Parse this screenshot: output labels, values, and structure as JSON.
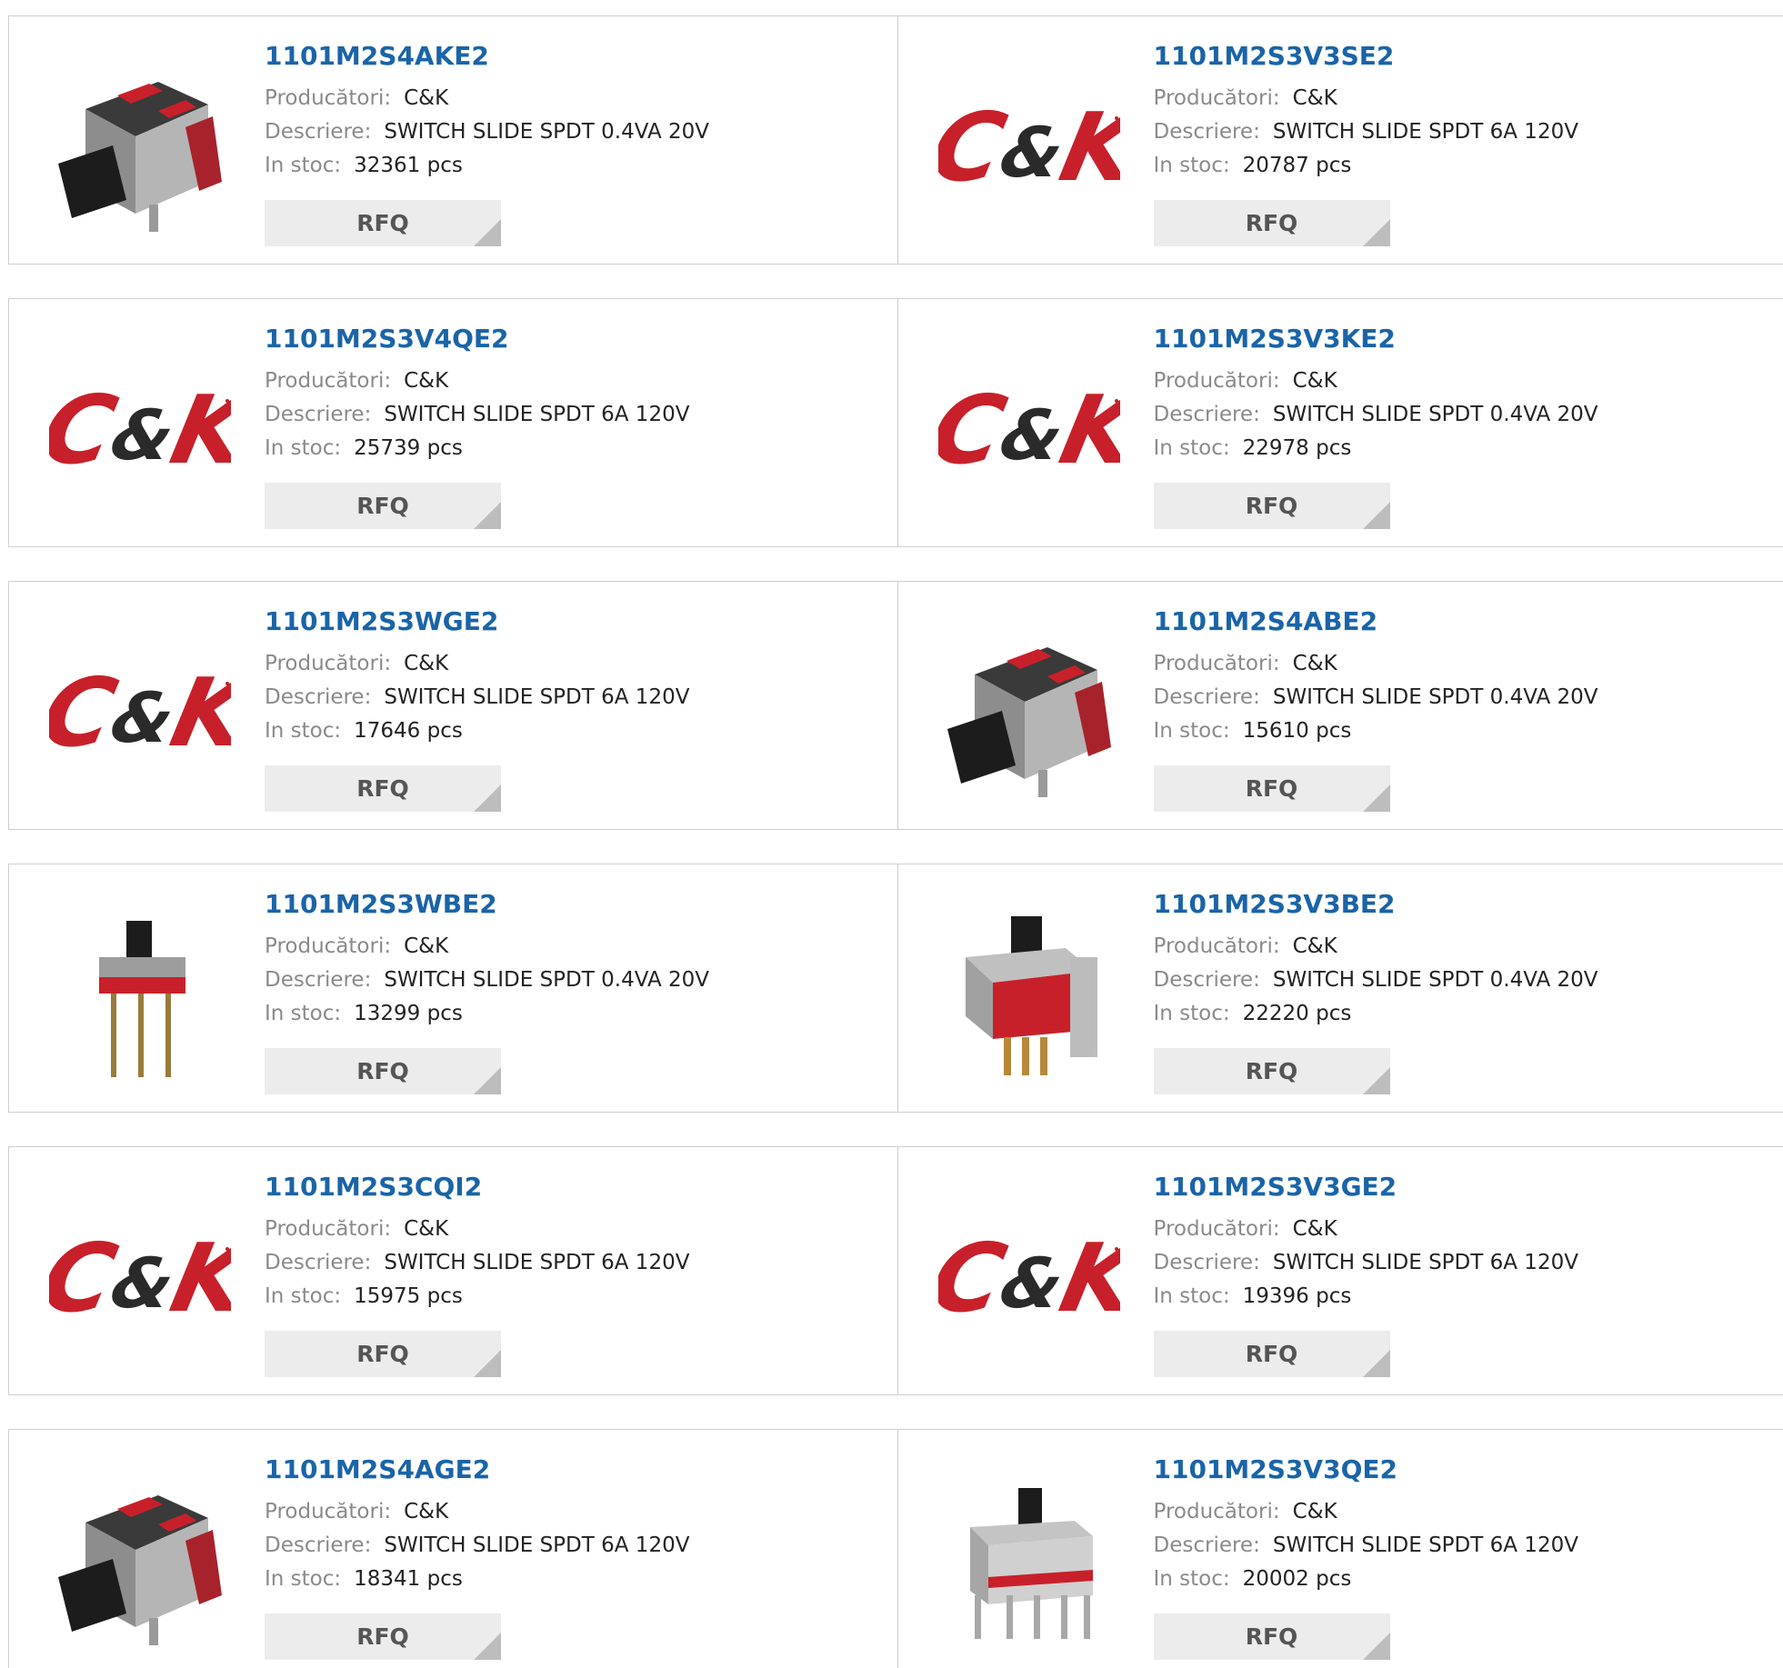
{
  "labels": {
    "manufacturer": "Producători:",
    "description": "Descriere:",
    "stock": "In stoc:",
    "rfq": "RFQ"
  },
  "brand_colors": {
    "logo_red": "#c8202a",
    "logo_dark": "#2a2a2a",
    "link_blue": "#1a64a8"
  },
  "logo_text": {
    "c": "C",
    "amp": "&",
    "k": "K"
  },
  "products": [
    {
      "part": "1101M2S4AKE2",
      "manufacturer": "C&K",
      "description": "SWITCH SLIDE SPDT 0.4VA 20V",
      "stock": "32361 pcs",
      "image": "right-angle-slide-switch"
    },
    {
      "part": "1101M2S3V3SE2",
      "manufacturer": "C&K",
      "description": "SWITCH SLIDE SPDT 6A 120V",
      "stock": "20787 pcs",
      "image": "ck-logo"
    },
    {
      "part": "1101M2S3V4QE2",
      "manufacturer": "C&K",
      "description": "SWITCH SLIDE SPDT 6A 120V",
      "stock": "25739 pcs",
      "image": "ck-logo"
    },
    {
      "part": "1101M2S3V3KE2",
      "manufacturer": "C&K",
      "description": "SWITCH SLIDE SPDT 0.4VA 20V",
      "stock": "22978 pcs",
      "image": "ck-logo"
    },
    {
      "part": "1101M2S3WGE2",
      "manufacturer": "C&K",
      "description": "SWITCH SLIDE SPDT 6A 120V",
      "stock": "17646 pcs",
      "image": "ck-logo"
    },
    {
      "part": "1101M2S4ABE2",
      "manufacturer": "C&K",
      "description": "SWITCH SLIDE SPDT 0.4VA 20V",
      "stock": "15610 pcs",
      "image": "right-angle-slide-switch"
    },
    {
      "part": "1101M2S3WBE2",
      "manufacturer": "C&K",
      "description": "SWITCH SLIDE SPDT 0.4VA 20V",
      "stock": "13299 pcs",
      "image": "vertical-pin-slide-switch"
    },
    {
      "part": "1101M2S3V3BE2",
      "manufacturer": "C&K",
      "description": "SWITCH SLIDE SPDT 0.4VA 20V",
      "stock": "22220 pcs",
      "image": "bracket-slide-switch"
    },
    {
      "part": "1101M2S3CQI2",
      "manufacturer": "C&K",
      "description": "SWITCH SLIDE SPDT 6A 120V",
      "stock": "15975 pcs",
      "image": "ck-logo"
    },
    {
      "part": "1101M2S3V3GE2",
      "manufacturer": "C&K",
      "description": "SWITCH SLIDE SPDT 6A 120V",
      "stock": "19396 pcs",
      "image": "ck-logo"
    },
    {
      "part": "1101M2S4AGE2",
      "manufacturer": "C&K",
      "description": "SWITCH SLIDE SPDT 6A 120V",
      "stock": "18341 pcs",
      "image": "right-angle-slide-switch"
    },
    {
      "part": "1101M2S3V3QE2",
      "manufacturer": "C&K",
      "description": "SWITCH SLIDE SPDT 6A 120V",
      "stock": "20002 pcs",
      "image": "pcb-slide-switch"
    }
  ]
}
